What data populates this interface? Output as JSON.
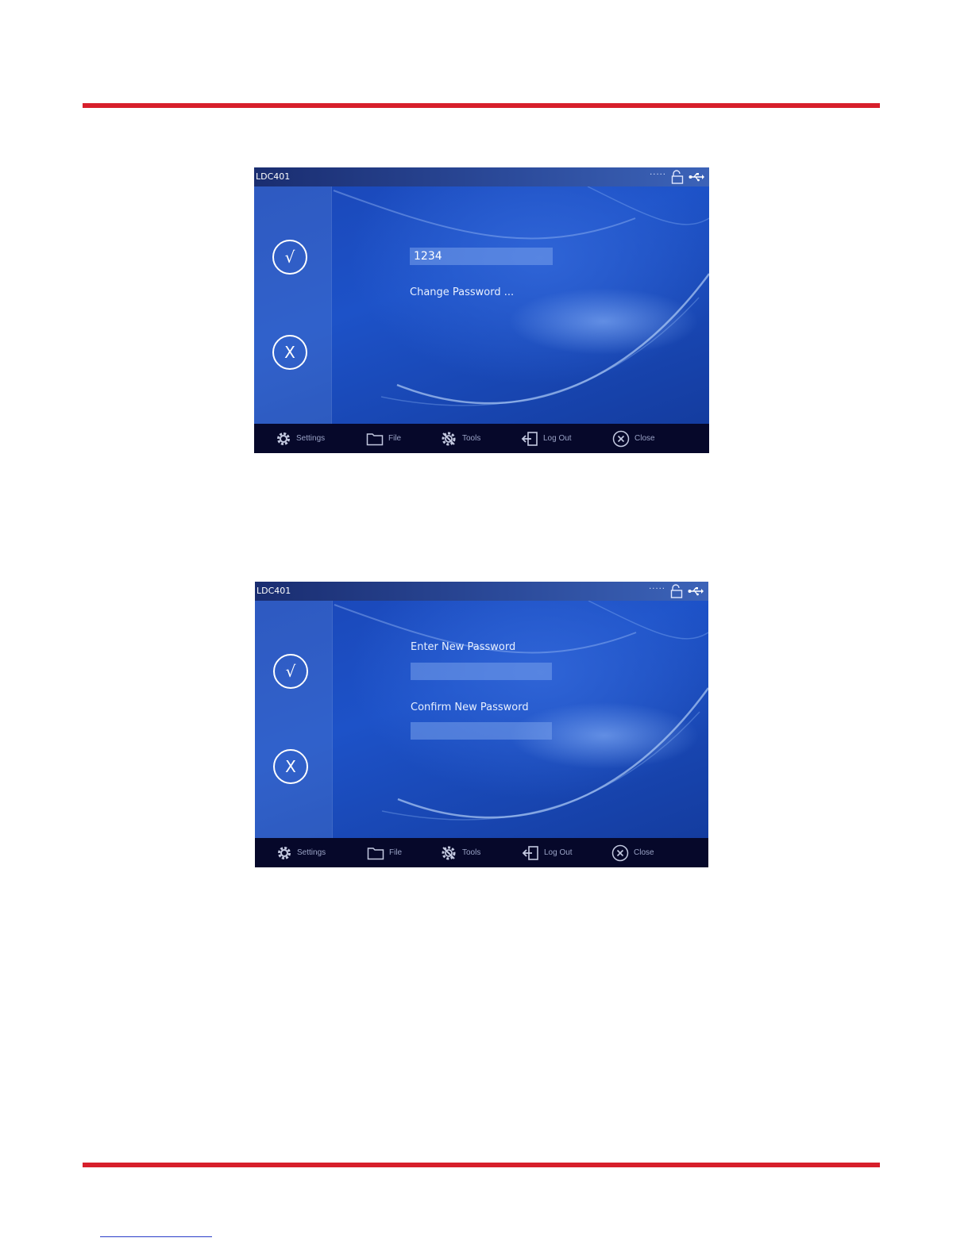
{
  "screens": [
    {
      "app_title": "LDC401",
      "status": {
        "signal": "·····",
        "lock_icon": "unlocked-padlock-icon",
        "usb_icon": "usb-icon"
      },
      "sidebar": {
        "ok_symbol": "√",
        "cancel_symbol": "X"
      },
      "password_field": {
        "value": "1234"
      },
      "change_password_link": "Change Password ...",
      "taskbar": [
        {
          "label": "Settings",
          "icon": "gear-icon"
        },
        {
          "label": "File",
          "icon": "folder-icon"
        },
        {
          "label": "Tools",
          "icon": "tools-gear-icon"
        },
        {
          "label": "Log Out",
          "icon": "logout-icon"
        },
        {
          "label": "Close",
          "icon": "close-circle-icon"
        }
      ]
    },
    {
      "app_title": "LDC401",
      "status": {
        "signal": "·····",
        "lock_icon": "unlocked-padlock-icon",
        "usb_icon": "usb-icon"
      },
      "sidebar": {
        "ok_symbol": "√",
        "cancel_symbol": "X"
      },
      "new_password_label": "Enter New Password",
      "new_password_value": "",
      "confirm_password_label": "Confirm New Password",
      "confirm_password_value": "",
      "taskbar": [
        {
          "label": "Settings",
          "icon": "gear-icon"
        },
        {
          "label": "File",
          "icon": "folder-icon"
        },
        {
          "label": "Tools",
          "icon": "tools-gear-icon"
        },
        {
          "label": "Log Out",
          "icon": "logout-icon"
        },
        {
          "label": "Close",
          "icon": "close-circle-icon"
        }
      ]
    }
  ],
  "colors": {
    "rule": "#d71f2b",
    "link_underline": "#2a3cc8",
    "taskbar": "#06082a"
  }
}
